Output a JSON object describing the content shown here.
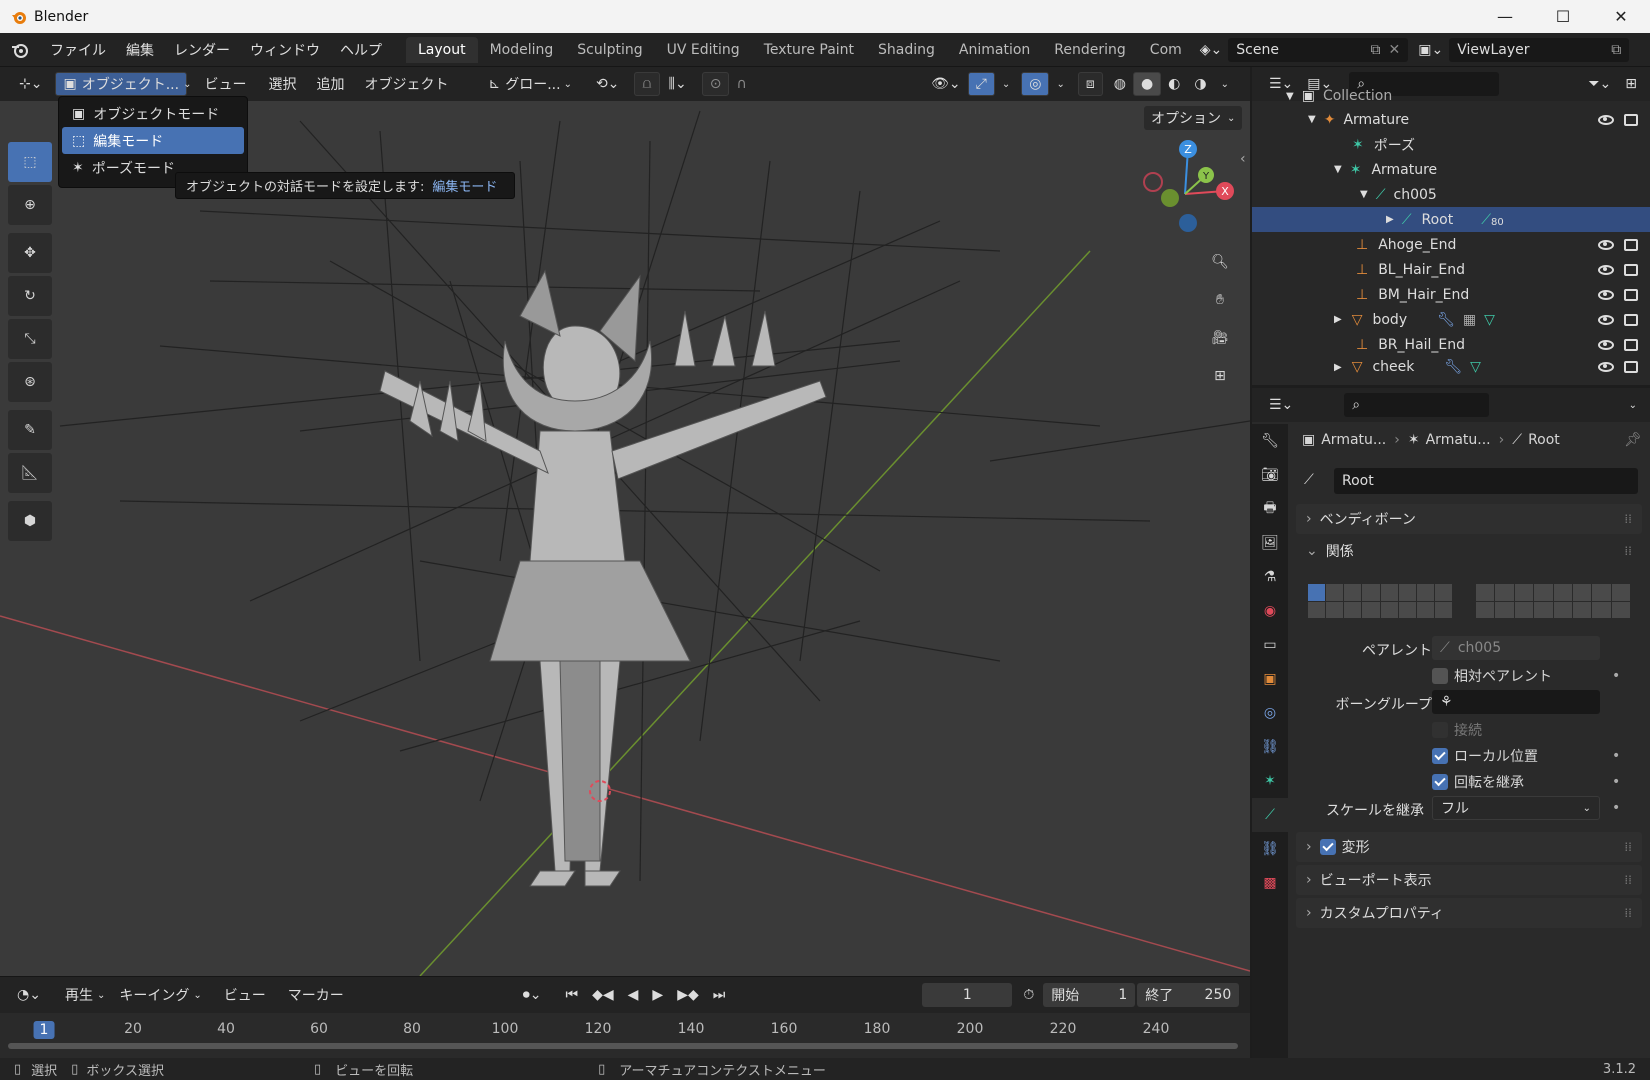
{
  "window": {
    "title": "Blender",
    "minimize": "—",
    "maximize": "☐",
    "close": "✕"
  },
  "menu": {
    "items": [
      "ファイル",
      "編集",
      "レンダー",
      "ウィンドウ",
      "ヘルプ"
    ]
  },
  "workspaces": {
    "tabs": [
      "Layout",
      "Modeling",
      "Sculpting",
      "UV Editing",
      "Texture Paint",
      "Shading",
      "Animation",
      "Rendering",
      "Com"
    ],
    "active": "Layout"
  },
  "scene": {
    "name": "Scene",
    "view_layer": "ViewLayer"
  },
  "viewport_header": {
    "mode_label": "オブジェクト...",
    "view": "ビュー",
    "select": "選択",
    "add": "追加",
    "object": "オブジェクト",
    "transform_orientation": "グロー...",
    "options": "オプション"
  },
  "mode_dropdown": {
    "items": [
      "オブジェクトモード",
      "編集モード",
      "ポーズモード"
    ],
    "selected": "編集モード"
  },
  "tooltip": {
    "text": "オブジェクトの対話モードを設定します:",
    "value": "編集モード"
  },
  "gizmo": {
    "z": "Z",
    "y": "Y",
    "x": "X"
  },
  "timeline": {
    "playback": "再生",
    "keying": "キーイング",
    "view": "ビュー",
    "marker": "マーカー",
    "current_frame": "1",
    "start_label": "開始",
    "start": "1",
    "end_label": "終了",
    "end": "250",
    "ruler": [
      "1",
      "20",
      "40",
      "60",
      "80",
      "100",
      "120",
      "140",
      "160",
      "180",
      "200",
      "220",
      "240"
    ]
  },
  "statusbar": {
    "select": "選択",
    "box_select": "ボックス選択",
    "rotate_view": "ビューを回転",
    "context_menu": "アーマチュアコンテクストメニュー",
    "version": "3.1.2"
  },
  "outliner": {
    "rows": [
      {
        "label": "Collection",
        "indent": 0
      },
      {
        "label": "Armature",
        "indent": 1
      },
      {
        "label": "ポーズ",
        "indent": 2
      },
      {
        "label": "Armature",
        "indent": 2
      },
      {
        "label": "ch005",
        "indent": 3
      },
      {
        "label": "Root",
        "indent": 4,
        "badge": "80"
      },
      {
        "label": "Ahoge_End",
        "indent": 2
      },
      {
        "label": "BL_Hair_End",
        "indent": 2
      },
      {
        "label": "BM_Hair_End",
        "indent": 2
      },
      {
        "label": "body",
        "indent": 2
      },
      {
        "label": "BR_Hail_End",
        "indent": 2
      },
      {
        "label": "cheek",
        "indent": 2
      }
    ]
  },
  "properties": {
    "breadcrumb": [
      "Armatu...",
      "Armatu...",
      "Root"
    ],
    "bone_name": "Root",
    "panels": {
      "bendy_bones": "ベンディボーン",
      "relations": "関係",
      "transform": "変形",
      "viewport_display": "ビューポート表示",
      "custom_props": "カスタムプロパティ"
    },
    "relations": {
      "parent_label": "ペアレント",
      "parent_value": "ch005",
      "relative_parent": "相対ペアレント",
      "bone_group_label": "ボーングループ",
      "connected": "接続",
      "local_location": "ローカル位置",
      "inherit_rotation": "回転を継承",
      "inherit_scale_label": "スケールを継承",
      "inherit_scale_value": "フル"
    }
  },
  "colors": {
    "accent": "#4772b3",
    "bone_teal": "#3fc9a8",
    "armature_orange": "#e08a3a",
    "x_axis": "#e04a5a",
    "y_axis": "#8bc34a",
    "z_axis": "#3b8fe0"
  }
}
